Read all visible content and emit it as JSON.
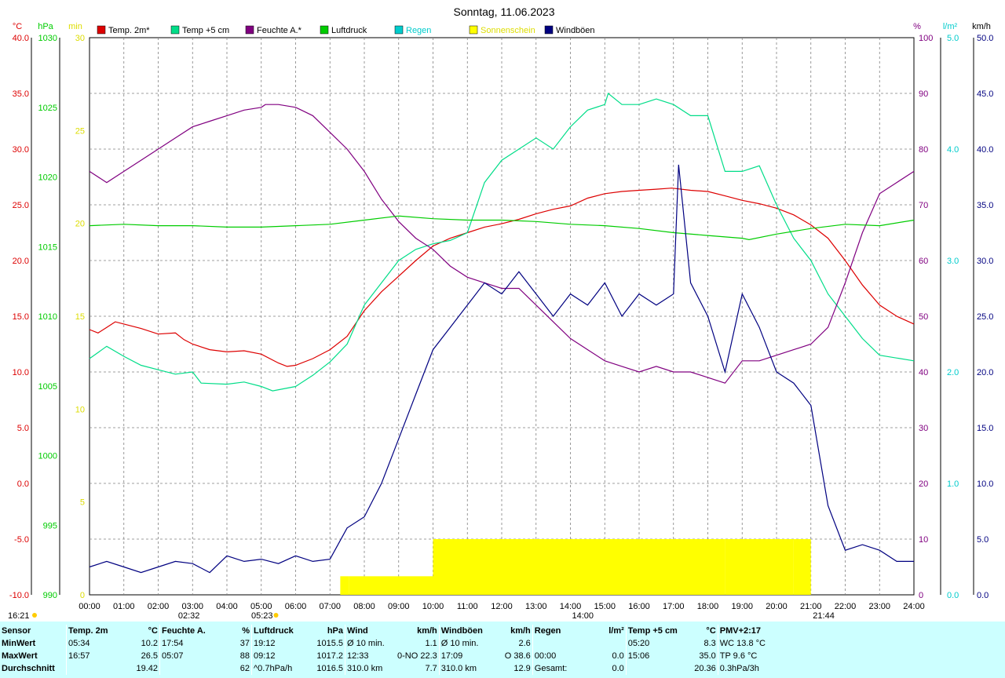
{
  "title": "Sonntag, 11.06.2023",
  "colors": {
    "temp2m": "#dd0000",
    "temp5cm": "#00dd88",
    "humidity": "#800080",
    "pressure": "#00cc00",
    "rain": "#00cccc",
    "sunshine": "#ffff00",
    "gusts": "#000080",
    "grid": "#808080"
  },
  "legend": [
    {
      "key": "temp2m",
      "label": "Temp. 2m*",
      "color": "#dd0000"
    },
    {
      "key": "temp5cm",
      "label": "Temp +5 cm",
      "color": "#00dd88"
    },
    {
      "key": "humidity",
      "label": "Feuchte A.*",
      "color": "#800080"
    },
    {
      "key": "pressure",
      "label": "Luftdruck",
      "color": "#00cc00"
    },
    {
      "key": "rain",
      "label": "Regen",
      "color": "#00cccc"
    },
    {
      "key": "sunshine",
      "label": "Sonnenschein",
      "color": "#ffff00"
    },
    {
      "key": "gusts",
      "label": "Windböen",
      "color": "#000080"
    }
  ],
  "axes": {
    "temp": {
      "unit": "°C",
      "min": -10,
      "max": 40,
      "step": 5,
      "color": "#dd0000",
      "ticks": [
        "-10.0",
        "-5.0",
        "0.0",
        "5.0",
        "10.0",
        "15.0",
        "20.0",
        "25.0",
        "30.0",
        "35.0",
        "40.0"
      ]
    },
    "pressure": {
      "unit": "hPa",
      "min": 990,
      "max": 1030,
      "step": 5,
      "color": "#00cc00",
      "ticks": [
        "990",
        "995",
        "1000",
        "1005",
        "1010",
        "1015",
        "1020",
        "1025",
        "1030"
      ]
    },
    "sun": {
      "unit": "min",
      "min": 0,
      "max": 30,
      "step": 5,
      "color": "#dddd00",
      "ticks": [
        "0",
        "5",
        "10",
        "15",
        "20",
        "25",
        "30"
      ]
    },
    "humidity": {
      "unit": "%",
      "min": 0,
      "max": 100,
      "step": 10,
      "color": "#800080",
      "ticks": [
        "0",
        "10",
        "20",
        "30",
        "40",
        "50",
        "60",
        "70",
        "80",
        "90",
        "100"
      ]
    },
    "rain": {
      "unit": "l/m²",
      "min": 0,
      "max": 5,
      "step": 1,
      "color": "#00cccc",
      "ticks": [
        "0.0",
        "1.0",
        "2.0",
        "3.0",
        "4.0",
        "5.0"
      ]
    },
    "wind": {
      "unit": "km/h",
      "min": 0,
      "max": 50,
      "step": 5,
      "color": "#000080",
      "ticks": [
        "0.0",
        "5.0",
        "10.0",
        "15.0",
        "20.0",
        "25.0",
        "30.0",
        "35.0",
        "40.0",
        "45.0",
        "50.0"
      ]
    },
    "x_ticks": [
      "00:00",
      "01:00",
      "02:00",
      "03:00",
      "04:00",
      "05:00",
      "06:00",
      "07:00",
      "08:00",
      "09:00",
      "10:00",
      "11:00",
      "12:00",
      "13:00",
      "14:00",
      "15:00",
      "16:00",
      "17:00",
      "18:00",
      "19:00",
      "20:00",
      "21:00",
      "22:00",
      "23:00",
      "24:00"
    ]
  },
  "markers": {
    "moonrise": "02:32",
    "sunrise": "05:23",
    "noon": "14:00",
    "sunset": "21:44",
    "moonset": "16:21"
  },
  "chart_data": {
    "type": "line",
    "title": "Sonntag, 11.06.2023",
    "x_unit": "hour",
    "xlim": [
      0,
      24
    ],
    "series": [
      {
        "name": "Temp. 2m*",
        "axis": "temp",
        "points": [
          [
            0,
            13.8
          ],
          [
            0.25,
            13.5
          ],
          [
            0.5,
            14.0
          ],
          [
            0.75,
            14.5
          ],
          [
            1,
            14.3
          ],
          [
            1.5,
            13.9
          ],
          [
            2,
            13.4
          ],
          [
            2.5,
            13.5
          ],
          [
            2.75,
            12.9
          ],
          [
            3,
            12.5
          ],
          [
            3.5,
            12.0
          ],
          [
            4,
            11.8
          ],
          [
            4.5,
            11.9
          ],
          [
            5,
            11.6
          ],
          [
            5.5,
            10.8
          ],
          [
            5.75,
            10.5
          ],
          [
            6,
            10.6
          ],
          [
            6.5,
            11.2
          ],
          [
            7,
            12.0
          ],
          [
            7.5,
            13.2
          ],
          [
            8,
            15.5
          ],
          [
            8.5,
            17.2
          ],
          [
            9,
            18.6
          ],
          [
            9.5,
            20.0
          ],
          [
            10,
            21.3
          ],
          [
            10.5,
            22.0
          ],
          [
            11,
            22.5
          ],
          [
            11.5,
            23.0
          ],
          [
            12,
            23.3
          ],
          [
            12.5,
            23.7
          ],
          [
            13,
            24.2
          ],
          [
            13.5,
            24.6
          ],
          [
            14,
            24.9
          ],
          [
            14.5,
            25.6
          ],
          [
            15,
            26.0
          ],
          [
            15.5,
            26.2
          ],
          [
            16,
            26.3
          ],
          [
            16.5,
            26.4
          ],
          [
            16.95,
            26.5
          ],
          [
            17.5,
            26.3
          ],
          [
            18,
            26.2
          ],
          [
            18.5,
            25.8
          ],
          [
            19,
            25.4
          ],
          [
            19.5,
            25.1
          ],
          [
            20,
            24.7
          ],
          [
            20.5,
            24.1
          ],
          [
            21,
            23.2
          ],
          [
            21.5,
            22.0
          ],
          [
            22,
            20.0
          ],
          [
            22.5,
            17.8
          ],
          [
            23,
            16.0
          ],
          [
            23.5,
            15.0
          ],
          [
            24,
            14.3
          ]
        ]
      },
      {
        "name": "Temp +5 cm",
        "axis": "temp",
        "points": [
          [
            0,
            11.2
          ],
          [
            0.5,
            12.3
          ],
          [
            1,
            11.4
          ],
          [
            1.5,
            10.6
          ],
          [
            2,
            10.2
          ],
          [
            2.5,
            9.8
          ],
          [
            3,
            10.0
          ],
          [
            3.25,
            9.0
          ],
          [
            4,
            8.9
          ],
          [
            4.5,
            9.1
          ],
          [
            5,
            8.7
          ],
          [
            5.33,
            8.3
          ],
          [
            6,
            8.7
          ],
          [
            6.5,
            9.7
          ],
          [
            7,
            10.9
          ],
          [
            7.5,
            12.5
          ],
          [
            8,
            16.0
          ],
          [
            8.5,
            18.0
          ],
          [
            9,
            20.0
          ],
          [
            9.5,
            21.0
          ],
          [
            10,
            21.5
          ],
          [
            10.5,
            21.8
          ],
          [
            11,
            22.5
          ],
          [
            11.5,
            27.0
          ],
          [
            12,
            29.0
          ],
          [
            12.5,
            30.0
          ],
          [
            13,
            31.0
          ],
          [
            13.5,
            30.0
          ],
          [
            14,
            32.0
          ],
          [
            14.5,
            33.5
          ],
          [
            15,
            34.0
          ],
          [
            15.1,
            35.0
          ],
          [
            15.5,
            34.0
          ],
          [
            16,
            34.0
          ],
          [
            16.5,
            34.5
          ],
          [
            17,
            34.0
          ],
          [
            17.5,
            33.0
          ],
          [
            18,
            33.0
          ],
          [
            18.5,
            28.0
          ],
          [
            19,
            28.0
          ],
          [
            19.5,
            28.5
          ],
          [
            20,
            25.0
          ],
          [
            20.5,
            22.0
          ],
          [
            21,
            20.0
          ],
          [
            21.5,
            17.0
          ],
          [
            22,
            15.0
          ],
          [
            22.5,
            13.0
          ],
          [
            23,
            11.5
          ],
          [
            24,
            11.0
          ]
        ]
      },
      {
        "name": "Feuchte A.*",
        "axis": "humidity",
        "points": [
          [
            0,
            76
          ],
          [
            0.5,
            74
          ],
          [
            1,
            76
          ],
          [
            1.5,
            78
          ],
          [
            2,
            80
          ],
          [
            2.5,
            82
          ],
          [
            3,
            84
          ],
          [
            3.5,
            85
          ],
          [
            4,
            86
          ],
          [
            4.5,
            87
          ],
          [
            5,
            87.5
          ],
          [
            5.12,
            88
          ],
          [
            5.5,
            88
          ],
          [
            6,
            87.5
          ],
          [
            6.5,
            86
          ],
          [
            7,
            83
          ],
          [
            7.5,
            80
          ],
          [
            8,
            76
          ],
          [
            8.5,
            71
          ],
          [
            9,
            67
          ],
          [
            9.5,
            64
          ],
          [
            10,
            62
          ],
          [
            10.5,
            59
          ],
          [
            11,
            57
          ],
          [
            11.5,
            56
          ],
          [
            12,
            55
          ],
          [
            12.5,
            55
          ],
          [
            13,
            52
          ],
          [
            13.5,
            49
          ],
          [
            14,
            46
          ],
          [
            14.5,
            44
          ],
          [
            15,
            42
          ],
          [
            15.5,
            41
          ],
          [
            16,
            40
          ],
          [
            16.5,
            41
          ],
          [
            17,
            40
          ],
          [
            17.5,
            40
          ],
          [
            18,
            39
          ],
          [
            18.5,
            38
          ],
          [
            19,
            42
          ],
          [
            19.5,
            42
          ],
          [
            20,
            43
          ],
          [
            20.5,
            44
          ],
          [
            21,
            45
          ],
          [
            21.5,
            48
          ],
          [
            22,
            56
          ],
          [
            22.5,
            65
          ],
          [
            23,
            72
          ],
          [
            23.5,
            74
          ],
          [
            24,
            76
          ]
        ]
      },
      {
        "name": "Luftdruck",
        "axis": "pressure",
        "points": [
          [
            0,
            1016.5
          ],
          [
            1,
            1016.6
          ],
          [
            2,
            1016.5
          ],
          [
            3,
            1016.5
          ],
          [
            4,
            1016.4
          ],
          [
            5,
            1016.4
          ],
          [
            6,
            1016.5
          ],
          [
            7,
            1016.6
          ],
          [
            8,
            1016.9
          ],
          [
            9,
            1017.2
          ],
          [
            10,
            1017.0
          ],
          [
            11,
            1016.9
          ],
          [
            12,
            1016.9
          ],
          [
            13,
            1016.8
          ],
          [
            14,
            1016.6
          ],
          [
            15,
            1016.5
          ],
          [
            16,
            1016.3
          ],
          [
            17,
            1016.0
          ],
          [
            18,
            1015.8
          ],
          [
            19,
            1015.6
          ],
          [
            19.2,
            1015.5
          ],
          [
            20,
            1015.9
          ],
          [
            21,
            1016.3
          ],
          [
            22,
            1016.6
          ],
          [
            23,
            1016.5
          ],
          [
            24,
            1016.9
          ]
        ]
      },
      {
        "name": "Windböen",
        "axis": "wind",
        "points": [
          [
            0,
            2.5
          ],
          [
            0.5,
            3.0
          ],
          [
            1,
            2.5
          ],
          [
            1.5,
            2.0
          ],
          [
            2,
            2.5
          ],
          [
            2.5,
            3.0
          ],
          [
            3,
            2.8
          ],
          [
            3.5,
            2.0
          ],
          [
            4,
            3.5
          ],
          [
            4.5,
            3.0
          ],
          [
            5,
            3.2
          ],
          [
            5.5,
            2.8
          ],
          [
            6,
            3.5
          ],
          [
            6.5,
            3.0
          ],
          [
            7,
            3.2
          ],
          [
            7.5,
            6.0
          ],
          [
            8,
            7.0
          ],
          [
            8.5,
            10.0
          ],
          [
            9,
            14.0
          ],
          [
            9.5,
            18.0
          ],
          [
            10,
            22.0
          ],
          [
            10.5,
            24.0
          ],
          [
            11,
            26.0
          ],
          [
            11.5,
            28.0
          ],
          [
            12,
            27.0
          ],
          [
            12.5,
            29.0
          ],
          [
            13,
            27.0
          ],
          [
            13.5,
            25.0
          ],
          [
            14,
            27.0
          ],
          [
            14.5,
            26.0
          ],
          [
            15,
            28.0
          ],
          [
            15.5,
            25.0
          ],
          [
            16,
            27.0
          ],
          [
            16.5,
            26.0
          ],
          [
            17,
            27.0
          ],
          [
            17.15,
            38.6
          ],
          [
            17.5,
            28.0
          ],
          [
            18,
            25.0
          ],
          [
            18.5,
            20.0
          ],
          [
            19,
            27.0
          ],
          [
            19.5,
            24.0
          ],
          [
            20,
            20.0
          ],
          [
            20.5,
            19.0
          ],
          [
            21,
            17.0
          ],
          [
            21.5,
            8.0
          ],
          [
            22,
            4.0
          ],
          [
            22.5,
            4.5
          ],
          [
            23,
            4.0
          ],
          [
            23.5,
            3.0
          ],
          [
            24,
            3.0
          ]
        ]
      },
      {
        "name": "Sonnenschein",
        "axis": "sun",
        "type": "bar",
        "segments": [
          [
            7.3,
            7.55,
            1
          ],
          [
            7.55,
            10.0,
            1
          ],
          [
            10.0,
            18.5,
            3
          ],
          [
            18.5,
            19.2,
            3
          ],
          [
            19.2,
            20.5,
            3
          ],
          [
            20.5,
            21.0,
            3
          ]
        ]
      }
    ]
  },
  "stats": {
    "row_labels": [
      "Sensor",
      "MinWert",
      "MaxWert",
      "Durchschnitt"
    ],
    "temp2m": {
      "header": "Temp. 2m",
      "unit": "°C",
      "min_time": "05:34",
      "min_val": "10.2",
      "max_time": "16:57",
      "max_val": "26.5",
      "avg": "19.42"
    },
    "humidity": {
      "header": "Feuchte A.",
      "unit": "%",
      "min_time": "17:54",
      "min_val": "37",
      "max_time": "05:07",
      "max_val": "88",
      "avg": "62"
    },
    "pressure": {
      "header": "Luftdruck",
      "unit": "hPa",
      "min_time": "19:12",
      "min_val": "1015.5",
      "max_time": "09:12",
      "max_val": "1017.2",
      "trend": "^0.7hPa/h",
      "avg": "1016.5"
    },
    "wind": {
      "header": "Wind",
      "unit": "km/h",
      "min_label": "Ø 10 min.",
      "min_val": "1.1",
      "max_time": "12:33",
      "max_dir": "0-NO",
      "max_val": "22.3",
      "avg_label": "310.0 km",
      "avg": "7.7"
    },
    "gusts": {
      "header": "Windböen",
      "unit": "km/h",
      "min_label": "Ø 10 min.",
      "min_val": "2.6",
      "max_time": "17:09",
      "max_dir": "O",
      "max_val": "38.6",
      "avg_label": "310.0 km",
      "avg": "12.9"
    },
    "rain": {
      "header": "Regen",
      "unit": "l/m²",
      "max_time": "00:00",
      "max_val": "0.0",
      "avg_label": "Gesamt:",
      "avg": "0.0"
    },
    "temp5cm": {
      "header": "Temp +5 cm",
      "unit": "°C",
      "min_time": "05:20",
      "min_val": "8.3",
      "max_time": "15:06",
      "max_val": "35.0",
      "avg": "20.36"
    },
    "pmv": {
      "header": "PMV+2:17",
      "l1": "WC 13.8 °C",
      "l2": "TP 9.6 °C",
      "l3": "0.3hPa/3h"
    }
  }
}
